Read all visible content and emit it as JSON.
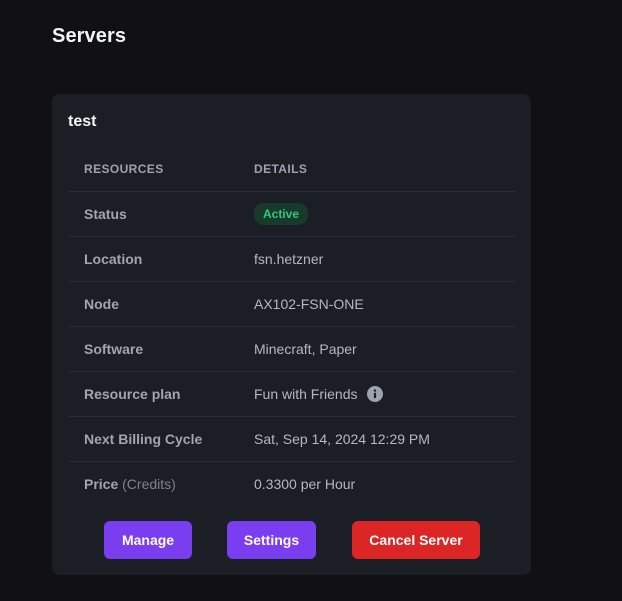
{
  "page": {
    "title": "Servers"
  },
  "server": {
    "name": "test",
    "table": {
      "header": {
        "resources": "RESOURCES",
        "details": "DETAILS"
      },
      "rows": [
        {
          "label": "Status",
          "value": "Active"
        },
        {
          "label": "Location",
          "value": "fsn.hetzner"
        },
        {
          "label": "Node",
          "value": "AX102-FSN-ONE"
        },
        {
          "label": "Software",
          "value": "Minecraft, Paper"
        },
        {
          "label": "Resource plan",
          "value": "Fun with Friends"
        },
        {
          "label": "Next Billing Cycle",
          "value": "Sat, Sep 14, 2024 12:29 PM"
        },
        {
          "label": "Price",
          "sublabel": "(Credits)",
          "value": "0.3300 per Hour"
        }
      ]
    },
    "actions": {
      "manage_label": "Manage",
      "settings_label": "Settings",
      "cancel_label": "Cancel Server"
    }
  },
  "icons": {
    "resource_plan_info": "info-icon"
  },
  "colors": {
    "background": "#111114",
    "card": "#1c1e25",
    "primary": "#7a3df0",
    "danger": "#dc2626",
    "status_active_text": "#34c77b",
    "status_active_bg": "#173a2c"
  }
}
